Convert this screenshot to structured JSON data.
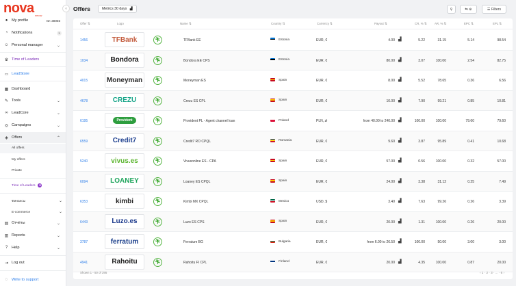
{
  "brand": {
    "name": "nova",
    "sub": "smow"
  },
  "sidebar": {
    "profile": {
      "label": "My profile",
      "id": "ID: 30003"
    },
    "notifications": {
      "label": "Notifications",
      "count": "3"
    },
    "manager": {
      "label": "Personal manager"
    },
    "time_of_leaders": "Time of Leaders",
    "leadstore": "LeadStore",
    "items": [
      {
        "label": "Dashboard",
        "icon": "grid-icon"
      },
      {
        "label": "Tools",
        "icon": "wrench-icon"
      },
      {
        "label": "LeadCore",
        "icon": "link-icon"
      },
      {
        "label": "Campaigns",
        "icon": "target-icon"
      },
      {
        "label": "Offers",
        "icon": "tag-icon"
      }
    ],
    "offers_sub": [
      "All offers",
      "My offers",
      "Private"
    ],
    "offers_leaders": "Time of Leaders",
    "offers_leaders_badge": "",
    "finance": "Финансы",
    "ecommerce": "E-commerce",
    "reports_ru": "Отчёты",
    "reports": "Reports",
    "help": "Help",
    "logout": "Log out",
    "support": "Write to support"
  },
  "header": {
    "title": "Offers",
    "metrics": "Metrics 30 days",
    "filters": "Filters"
  },
  "table": {
    "columns": {
      "offer": "Offer",
      "logo": "Logo",
      "name": "Name",
      "country": "Country",
      "currency": "Currency",
      "payout": "Payout",
      "cr": "CR, %",
      "ar": "AR, %",
      "epc": "EPC",
      "epl": "EPL"
    },
    "rows": [
      {
        "id": "1456",
        "brand": "TFBank",
        "name": "TFBank EE",
        "country": "Estonia",
        "flag": [
          "#0072ce",
          "#000000",
          "#ffffff"
        ],
        "currency": "EUR, €",
        "payout": "4.00",
        "cr": "5.22",
        "ar": "31.15",
        "epc": "5.14",
        "epl": "98.54",
        "color": "#c2593a"
      },
      {
        "id": "1034",
        "brand": "Bondora",
        "name": "Bondora EE CPS",
        "country": "Estonia",
        "flag": [
          "#0072ce",
          "#000000",
          "#ffffff"
        ],
        "currency": "EUR, €",
        "payout": "80.00",
        "cr": "3.07",
        "ar": "100.00",
        "epc": "2.54",
        "epl": "82.75",
        "color": "#111111"
      },
      {
        "id": "4015",
        "brand": "Moneyman",
        "name": "Moneyman ES",
        "country": "Spain",
        "flag": [
          "#c60b1e",
          "#ffc400",
          "#c60b1e"
        ],
        "currency": "EUR, €",
        "payout": "8.00",
        "cr": "5.52",
        "ar": "78.65",
        "epc": "0.36",
        "epl": "6.56",
        "color": "#2a2a2a"
      },
      {
        "id": "4678",
        "brand": "CREZU",
        "name": "Crezu ES CPL",
        "country": "Spain",
        "flag": [
          "#c60b1e",
          "#ffc400",
          "#c60b1e"
        ],
        "currency": "EUR, €",
        "payout": "10.00",
        "cr": "7.90",
        "ar": "99.21",
        "epc": "0.85",
        "epl": "10.81",
        "color": "#17a589"
      },
      {
        "id": "6195",
        "brand": "Provident",
        "name": "Provident PL - Agent channel loan",
        "country": "Poland",
        "flag": [
          "#ffffff",
          "#dc143c",
          "#dc143c"
        ],
        "currency": "PLN, zł",
        "payout": "from 40.00 to 240.00",
        "cr": "100.00",
        "ar": "100.00",
        "epc": "79.60",
        "epl": "79.60",
        "color": "#ffffff"
      },
      {
        "id": "6559",
        "brand": "Credit7",
        "name": "Credit7 RO CPQL",
        "country": "Romania",
        "flag": [
          "#002b7f",
          "#fcd116",
          "#ce1126"
        ],
        "currency": "EUR, €",
        "payout": "9.60",
        "cr": "3.87",
        "ar": "95.89",
        "epc": "0.41",
        "epl": "10.68",
        "color": "#1d3f8f"
      },
      {
        "id": "5240",
        "brand": "vivus.es",
        "name": "Vivusonline ES - CPA",
        "country": "Spain",
        "flag": [
          "#c60b1e",
          "#ffc400",
          "#c60b1e"
        ],
        "currency": "EUR, €",
        "payout": "57.00",
        "cr": "0.56",
        "ar": "100.00",
        "epc": "0.32",
        "epl": "57.00",
        "color": "#5cb530"
      },
      {
        "id": "6094",
        "brand": "LOANEY",
        "name": "Loaney ES CPQL",
        "country": "Spain",
        "flag": [
          "#c60b1e",
          "#ffc400",
          "#c60b1e"
        ],
        "currency": "EUR, €",
        "payout": "24.00",
        "cr": "3.38",
        "ar": "31.12",
        "epc": "0.25",
        "epl": "7.49",
        "color": "#1ca35a"
      },
      {
        "id": "6353",
        "brand": "kimbi",
        "name": "Kimbi MX CPQL",
        "country": "Mexico",
        "flag": [
          "#006847",
          "#ffffff",
          "#ce1126"
        ],
        "currency": "USD, $",
        "payout": "3.40",
        "cr": "7.63",
        "ar": "99.26",
        "epc": "0.26",
        "epl": "3.39",
        "color": "#222222"
      },
      {
        "id": "6443",
        "brand": "Luzo.es",
        "name": "Luzo ES CPS",
        "country": "Spain",
        "flag": [
          "#c60b1e",
          "#ffc400",
          "#c60b1e"
        ],
        "currency": "EUR, €",
        "payout": "20.00",
        "cr": "1.31",
        "ar": "100.00",
        "epc": "0.26",
        "epl": "20.00",
        "color": "#1c3a8c"
      },
      {
        "id": "3787",
        "brand": "ferratum",
        "name": "Ferratum BG",
        "country": "Bulgaria",
        "flag": [
          "#ffffff",
          "#00966e",
          "#d62612"
        ],
        "currency": "EUR, €",
        "payout": "from 6.00 to 26.50",
        "cr": "100.00",
        "ar": "50.00",
        "epc": "3.00",
        "epl": "3.00",
        "color": "#1b3f8b"
      },
      {
        "id": "4941",
        "brand": "Rahoitu",
        "name": "Rahoitu FI CPL",
        "country": "Finland",
        "flag": [
          "#ffffff",
          "#003580",
          "#ffffff"
        ],
        "currency": "EUR, €",
        "payout": "20.00",
        "cr": "4.35",
        "ar": "100.00",
        "epc": "0.87",
        "epl": "20.00",
        "color": "#222222"
      }
    ]
  },
  "footer": {
    "shown": "Shown 1 - 50 of 295",
    "pages": "‹  1  ·  2  ·  3  ·  ...  ·  6  ›"
  }
}
